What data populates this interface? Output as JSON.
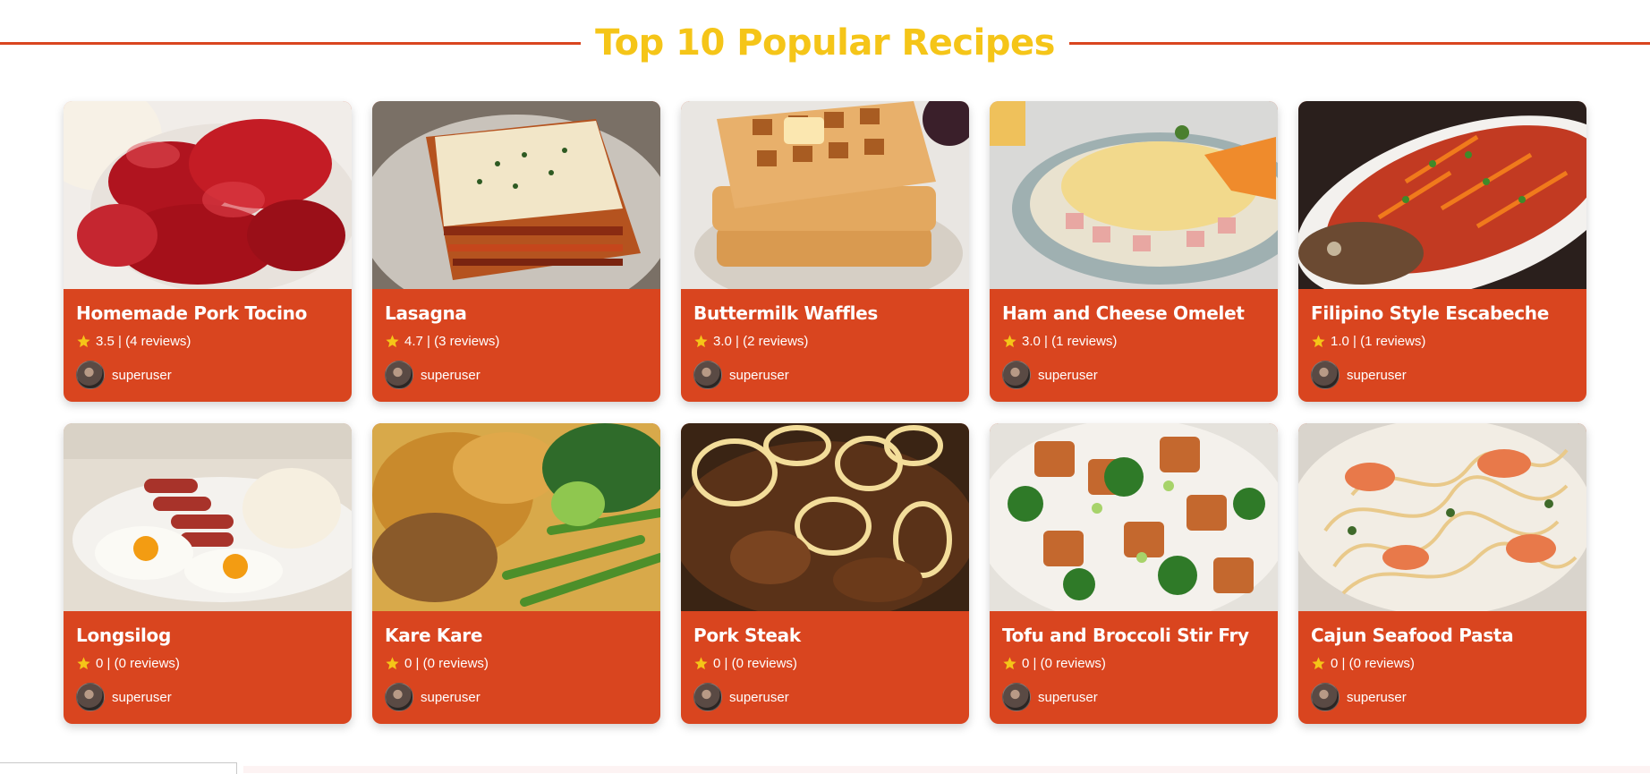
{
  "heading": "Top 10 Popular Recipes",
  "colors": {
    "accent": "#d9451f",
    "heading": "#f5c518",
    "star": "#f5c518"
  },
  "recipes": [
    {
      "title": "Homemade Pork Tocino",
      "rating": "3.5 | (4 reviews)",
      "author": "superuser",
      "image": "pork-tocino-photo"
    },
    {
      "title": "Lasagna",
      "rating": "4.7 | (3 reviews)",
      "author": "superuser",
      "image": "lasagna-photo"
    },
    {
      "title": "Buttermilk Waffles",
      "rating": "3.0 | (2 reviews)",
      "author": "superuser",
      "image": "waffles-photo"
    },
    {
      "title": "Ham and Cheese Omelet",
      "rating": "3.0 | (1 reviews)",
      "author": "superuser",
      "image": "omelet-photo"
    },
    {
      "title": "Filipino Style Escabeche",
      "rating": "1.0 | (1 reviews)",
      "author": "superuser",
      "image": "escabeche-photo"
    },
    {
      "title": "Longsilog",
      "rating": "0 | (0 reviews)",
      "author": "superuser",
      "image": "longsilog-photo"
    },
    {
      "title": "Kare Kare",
      "rating": "0 | (0 reviews)",
      "author": "superuser",
      "image": "kare-kare-photo"
    },
    {
      "title": "Pork Steak",
      "rating": "0 | (0 reviews)",
      "author": "superuser",
      "image": "pork-steak-photo"
    },
    {
      "title": "Tofu and Broccoli Stir Fry",
      "rating": "0 | (0 reviews)",
      "author": "superuser",
      "image": "tofu-broccoli-photo"
    },
    {
      "title": "Cajun Seafood Pasta",
      "rating": "0 | (0 reviews)",
      "author": "superuser",
      "image": "seafood-pasta-photo"
    }
  ]
}
